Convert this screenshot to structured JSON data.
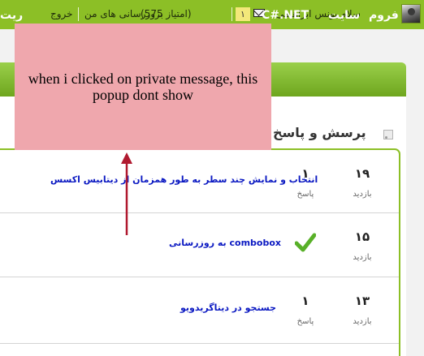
{
  "topbar": {
    "user_name": "سلام یونس ابراهیمی",
    "message_count": "۱",
    "score": "(575 امتیاز)",
    "my_blogs": "بروزرسانی های من",
    "logout": "خروج"
  },
  "nav": {
    "forum": "فروم",
    "site": "سایت",
    "dotnet": "C#.NET",
    "left_partial": "ریت"
  },
  "section": {
    "title": "پرسش و پاسخ"
  },
  "rows": [
    {
      "views": "۱۹",
      "views_label": "بازدید",
      "answers": "۱",
      "answers_label": "پاسخ",
      "title": "انتخاب و نمایش چند سطر به طور همزمان از دیتابیس اکسس"
    },
    {
      "views": "۱۵",
      "views_label": "بازدید",
      "answers_icon": "check-icon",
      "title": "به روزرسانی combobox"
    },
    {
      "views": "۱۳",
      "views_label": "بازدید",
      "answers": "۱",
      "answers_label": "پاسخ",
      "title": "جستجو در دیتاگریدویو"
    }
  ],
  "note": {
    "text": "when i clicked on private message, this popup dont show"
  },
  "colors": {
    "green": "#8cbf26",
    "note_pink": "#efa7ad",
    "arrow_red": "#b0192f",
    "link_blue": "#0b19c2"
  }
}
